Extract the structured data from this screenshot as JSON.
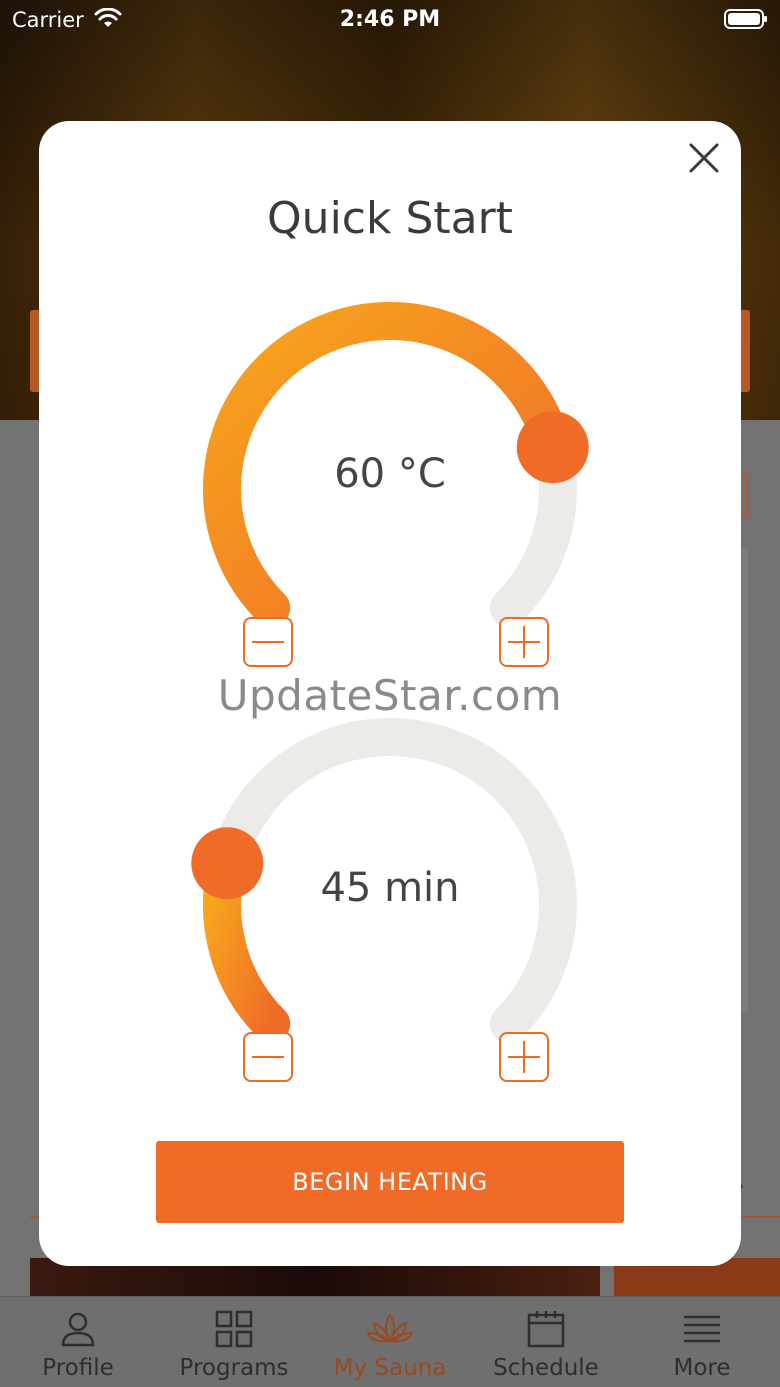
{
  "status_bar": {
    "carrier": "Carrier",
    "time": "2:46 PM"
  },
  "modal": {
    "title": "Quick Start",
    "temperature": {
      "value_label": "60 °C",
      "level": 0.78
    },
    "duration": {
      "value_label": "45 min",
      "level": 0.22
    },
    "watermark": "UpdateStar.com",
    "begin_button": "BEGIN HEATING"
  },
  "tabs": [
    {
      "label": "Profile",
      "icon": "person-icon"
    },
    {
      "label": "Programs",
      "icon": "grid-icon"
    },
    {
      "label": "My Sauna",
      "icon": "lotus-icon",
      "active": true
    },
    {
      "label": "Schedule",
      "icon": "calendar-icon"
    },
    {
      "label": "More",
      "icon": "menu-icon"
    }
  ],
  "colors": {
    "accent": "#ef6b27",
    "arc_start": "#f8a51e",
    "track": "#ecebe7"
  }
}
